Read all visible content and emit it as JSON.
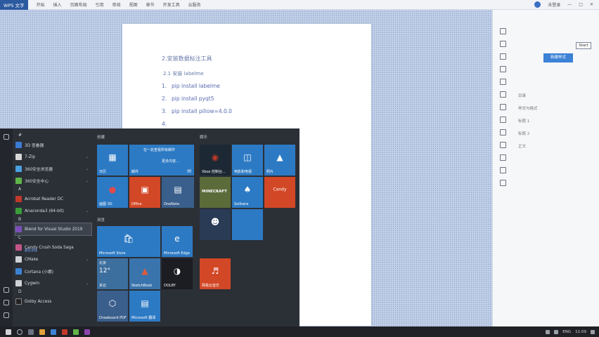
{
  "wps": {
    "app_badge": "WPS 文字",
    "menu": [
      "开始",
      "插入",
      "页面布局",
      "引用",
      "审阅",
      "视图",
      "章节",
      "开发工具",
      "云服务"
    ],
    "right_user": "未登录"
  },
  "document": {
    "heading": "2.安装数据标注工具",
    "subheading": "2.1 安装 labelme",
    "steps": [
      {
        "num": "1.",
        "text": "pip install labelme"
      },
      {
        "num": "2.",
        "text": "pip install pyqt5"
      },
      {
        "num": "3.",
        "text": "pip install pillow=4.0.0"
      },
      {
        "num": "4.",
        "text": ""
      }
    ]
  },
  "panel": {
    "start_button": "Start",
    "action_button": "新建样式",
    "lines": [
      "目录",
      "样式与格式",
      "标题 1",
      "标题 2",
      "正文"
    ]
  },
  "start_menu": {
    "apps": [
      {
        "letter": "#",
        "items": [
          {
            "name": "3D 查看器",
            "color": "#3c7bd4",
            "expand": false
          },
          {
            "name": "7-Zip",
            "color": "#d8d8d8",
            "expand": true
          },
          {
            "name": "360安全浏览器",
            "color": "#4aa0e0",
            "expand": true
          },
          {
            "name": "360安全中心",
            "color": "#5fb54a",
            "expand": true
          }
        ]
      },
      {
        "letter": "A",
        "items": [
          {
            "name": "Acrobat Reader DC",
            "color": "#c0392b",
            "expand": false
          },
          {
            "name": "Anaconda3 (64-bit)",
            "color": "#3a9d3a",
            "expand": true
          }
        ]
      },
      {
        "letter": "B",
        "items": [
          {
            "name": "Blend for Visual Studio 2019",
            "color": "#7b4fb8",
            "expand": false,
            "selected": true
          }
        ]
      },
      {
        "letter": "C",
        "items": [
          {
            "name": "Candy Crush Soda Saga",
            "color": "#c2558a",
            "expand": false,
            "sub": "最近添加"
          },
          {
            "name": "CMake",
            "color": "#cfd2d6",
            "expand": true
          },
          {
            "name": "Cortana (小娜)",
            "color": "#3b82d6",
            "expand": false
          },
          {
            "name": "Cygwin",
            "color": "#cfd2d6",
            "expand": true
          }
        ]
      },
      {
        "letter": "D",
        "items": [
          {
            "name": "Dolby Access",
            "color": "#222",
            "expand": false
          }
        ]
      }
    ],
    "section_left_1": "创建",
    "section_left_2": "浏览",
    "section_right": "娱乐",
    "tiles": {
      "calendar": "日历",
      "mail_title": "在一处查看所有邮件",
      "mail_sub": "更多内容...",
      "mail": "邮件",
      "paint3d": "画图 3D",
      "office": "Office",
      "onenote": "OneNote",
      "xbox": "Xbox 控制台...",
      "movies": "电影和电视",
      "photos": "照片",
      "minecraft": "MINECRAFT",
      "solitaire": "Solitaire",
      "candy": "Candy",
      "disney": "",
      "store": "Microsoft Store",
      "edge": "Microsoft Edge",
      "weather_temp": "12°",
      "weather_city": "北京",
      "weather_label": "多云",
      "sketch": "SketchBook",
      "dolby": "DOLBY",
      "netease": "网易云音乐",
      "drawboard": "Drawboard PDF",
      "translator": "Microsoft 翻译"
    }
  },
  "taskbar": {
    "tray_text": "ENG",
    "time": "11:09"
  }
}
